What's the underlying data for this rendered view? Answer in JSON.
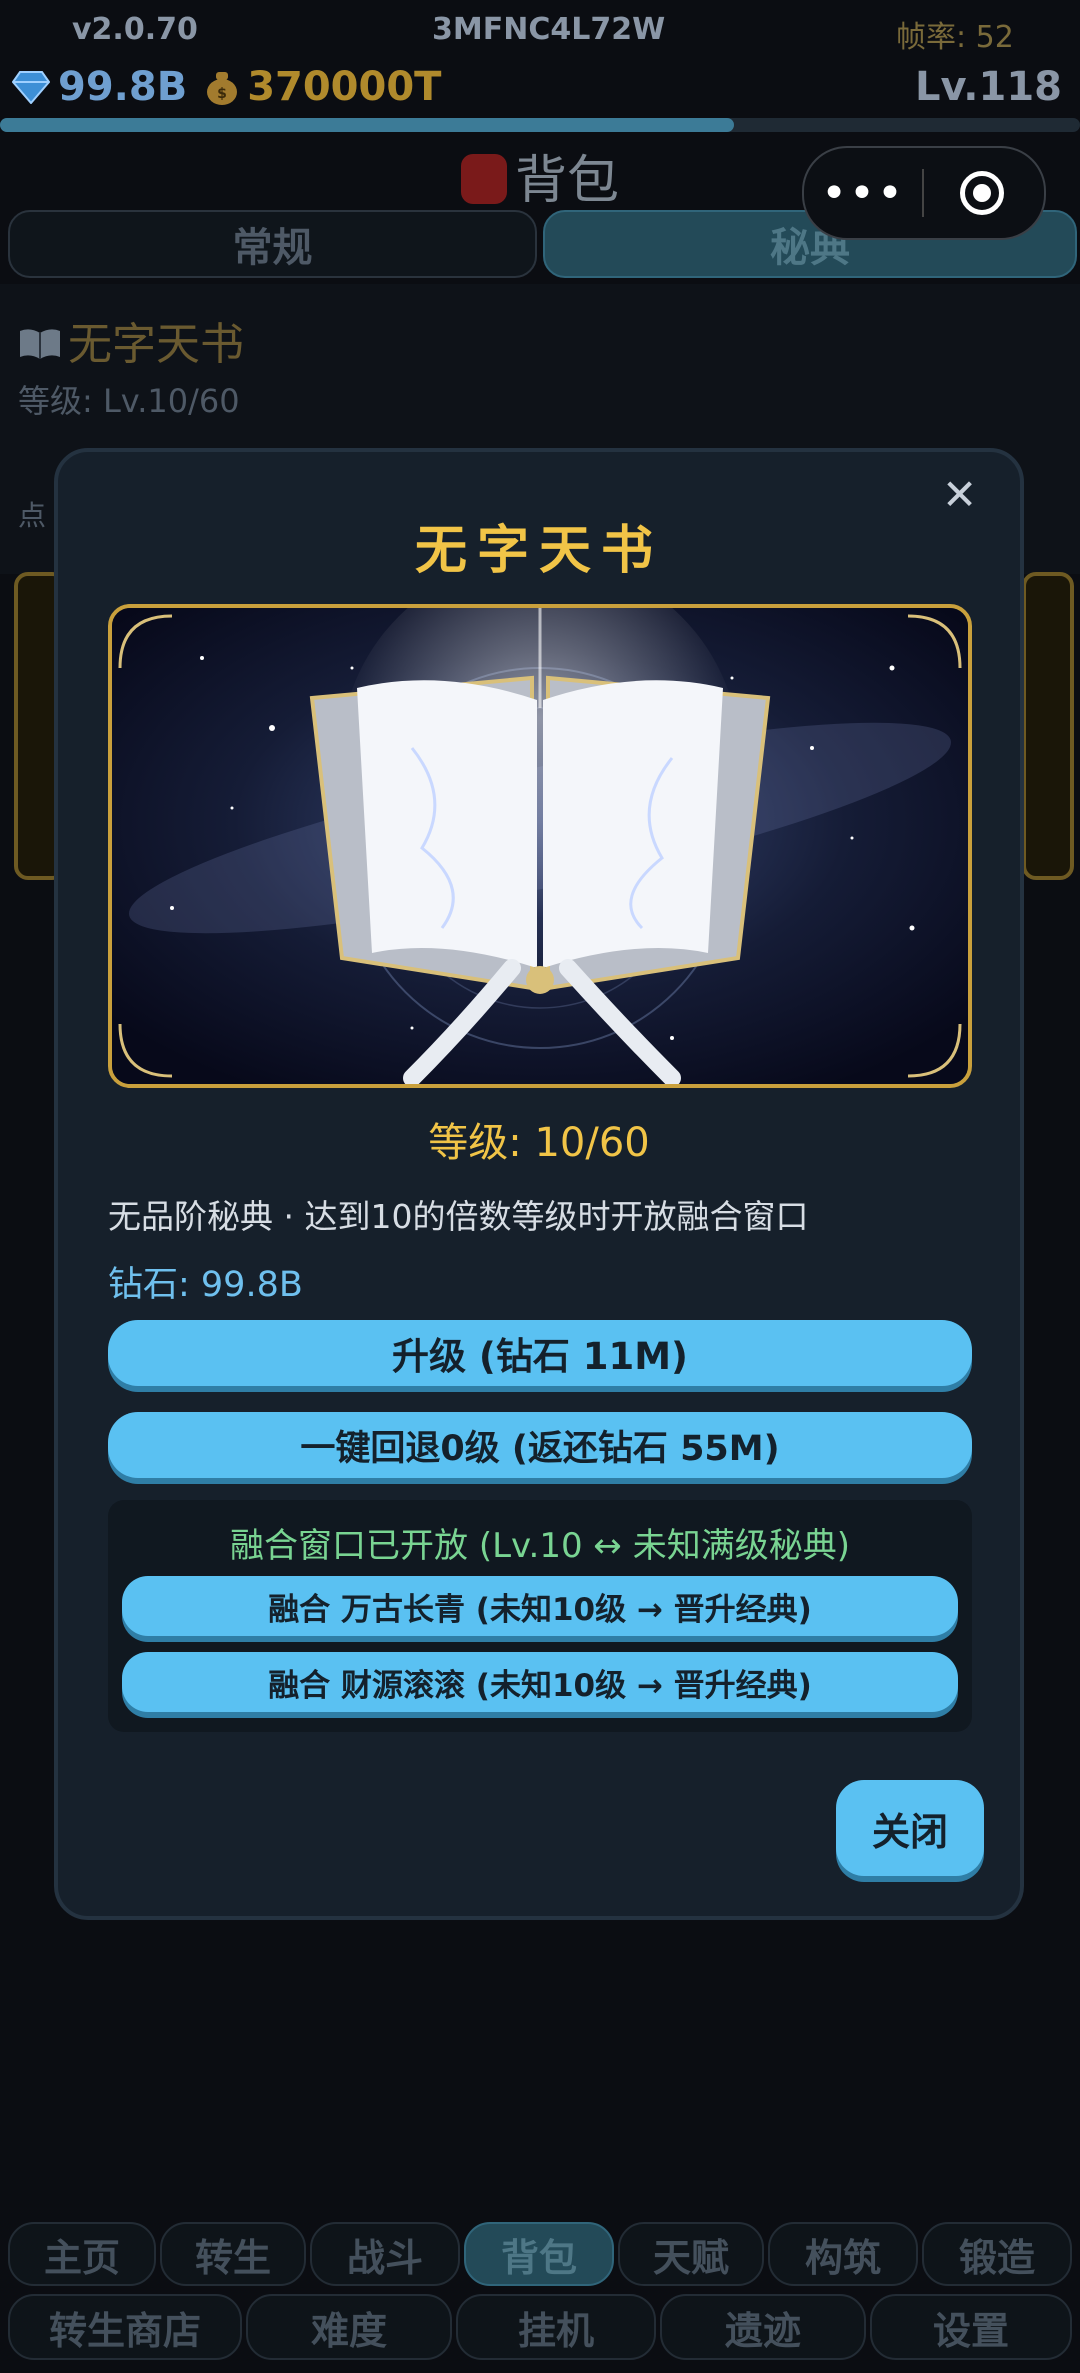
{
  "status": {
    "version": "v2.0.70",
    "uid": "3MFNC4L72W",
    "fps": "帧率: 52"
  },
  "currency": {
    "gems": "99.8B",
    "gold": "370000T",
    "level": "Lv.118",
    "xp_progress": 0.68
  },
  "bag": {
    "title": "背包"
  },
  "tabs": [
    {
      "label": "常规"
    },
    {
      "label": "秘典"
    }
  ],
  "list_item": {
    "title": "无字天书",
    "level": "等级: Lv.10/60",
    "hint": "点"
  },
  "modal": {
    "close_glyph": "✕",
    "title": "无字天书",
    "level": "等级: 10/60",
    "description": "无品阶秘典 · 达到10的倍数等级时开放融合窗口",
    "gems": "钻石: 99.8B",
    "upgrade_label": "升级 (钻石 11M)",
    "reset_label": "一键回退0级 (返还钻石 55M)",
    "fusion_title": "融合窗口已开放 (Lv.10 ↔ 未知满级秘典)",
    "fusion_options": [
      {
        "label": "融合 万古长青 (未知10级 → 晋升经典)"
      },
      {
        "label": "融合 财源滚滚 (未知10级 → 晋升经典)"
      }
    ],
    "close_label": "关闭"
  },
  "nav_row1": [
    {
      "label": "主页"
    },
    {
      "label": "转生"
    },
    {
      "label": "战斗"
    },
    {
      "label": "背包"
    },
    {
      "label": "天赋"
    },
    {
      "label": "构筑"
    },
    {
      "label": "锻造"
    }
  ],
  "nav_row2": [
    {
      "label": "转生商店"
    },
    {
      "label": "难度"
    },
    {
      "label": "挂机"
    },
    {
      "label": "遗迹"
    },
    {
      "label": "设置"
    }
  ],
  "colors": {
    "accent": "#5ac1f2",
    "gold": "#f1c447",
    "fusion_green": "#79d492",
    "modal_bg": "#16202b"
  },
  "icons": {
    "gem": "diamond-icon",
    "gold": "money-bag-icon",
    "bag": "backpack-icon",
    "book": "book-icon",
    "more": "more-dots-icon",
    "target": "target-icon",
    "close": "close-icon"
  }
}
